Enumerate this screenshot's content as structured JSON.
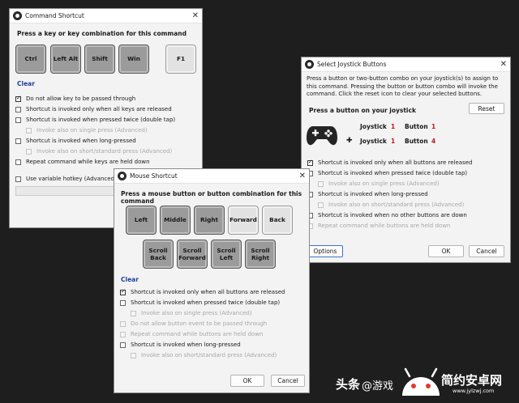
{
  "command_window": {
    "title": "Command Shortcut",
    "prompt": "Press a key or key combination for this command",
    "keys": [
      "Ctrl",
      "Left Alt",
      "Shift",
      "Win",
      "F1"
    ],
    "clear_label": "Clear",
    "options": [
      {
        "label": "Do not allow key to be passed through",
        "checked": true
      },
      {
        "label": "Shortcut is invoked only when all keys are released"
      },
      {
        "label": "Shortcut is invoked when pressed twice (double tap)"
      },
      {
        "label": "Invoke also on single press (Advanced)",
        "disabled": true
      },
      {
        "label": "Shortcut is invoked when long-pressed"
      },
      {
        "label": "Invoke also on short/standard press (Advanced)",
        "disabled": true
      },
      {
        "label": "Repeat command while keys are held down"
      },
      {
        "label": "Use variable hotkey (Advanced)"
      }
    ]
  },
  "mouse_window": {
    "title": "Mouse Shortcut",
    "prompt": "Press a mouse button or button combination for this command",
    "buttons_row1": [
      "Left",
      "Middle",
      "Right",
      "Forward",
      "Back"
    ],
    "buttons_row2": [
      "Scroll Back",
      "Scroll Forward",
      "Scroll Left",
      "Scroll Right"
    ],
    "clear_label": "Clear",
    "options": [
      {
        "label": "Shortcut is invoked only when all buttons are released",
        "checked": true
      },
      {
        "label": "Shortcut is invoked when pressed twice (double tap)"
      },
      {
        "label": "Invoke also on single press (Advanced)",
        "disabled": true
      },
      {
        "label": "Do not allow button event to be passed through",
        "disabled": true
      },
      {
        "label": "Repeat command while buttons are held down",
        "disabled": true
      },
      {
        "label": "Shortcut is invoked when long-pressed"
      },
      {
        "label": "Invoke also on short/standard press (Advanced)",
        "disabled": true
      }
    ],
    "ok_label": "OK",
    "cancel_label": "Cancel"
  },
  "joystick_window": {
    "title": "Select Joystick Buttons",
    "description": "Press a button or two-button combo on your joystick(s) to assign to this command.  Pressing the button or button combo will invoke the command. Click the reset icon to clear your selected buttons.",
    "prompt": "Press a button on your joystick",
    "reset_label": "Reset",
    "row1": {
      "joystick_label": "Joystick",
      "joystick_num": "1",
      "button_label": "Button",
      "button_num": "1"
    },
    "row2": {
      "joystick_label": "Joystick",
      "joystick_num": "1",
      "button_label": "Button",
      "button_num": "4"
    },
    "plus": "✚",
    "options": [
      {
        "label": "Shortcut is invoked only when all buttons are released",
        "checked": true
      },
      {
        "label": "Shortcut is invoked when pressed twice (double tap)"
      },
      {
        "label": "Invoke also on single press (Advanced)",
        "disabled": true
      },
      {
        "label": "Shortcut is invoked when long-pressed"
      },
      {
        "label": "Invoke also on short/standard press (Advanced)",
        "disabled": true
      },
      {
        "label": "Shortcut is invoked when no other buttons are down"
      },
      {
        "label": "Repeat command while buttons are held down",
        "disabled": true
      }
    ],
    "options_label": "Options",
    "ok_label": "OK",
    "cancel_label": "Cancel"
  },
  "watermark": {
    "prefix": "头条",
    "handle": "@游戏",
    "brand": "简约安卓网",
    "url": "www.jylzwj.com"
  },
  "colors": {
    "accent_red": "#c01818",
    "link_blue": "#1d3f9a",
    "focus_blue": "#3a74c4"
  }
}
